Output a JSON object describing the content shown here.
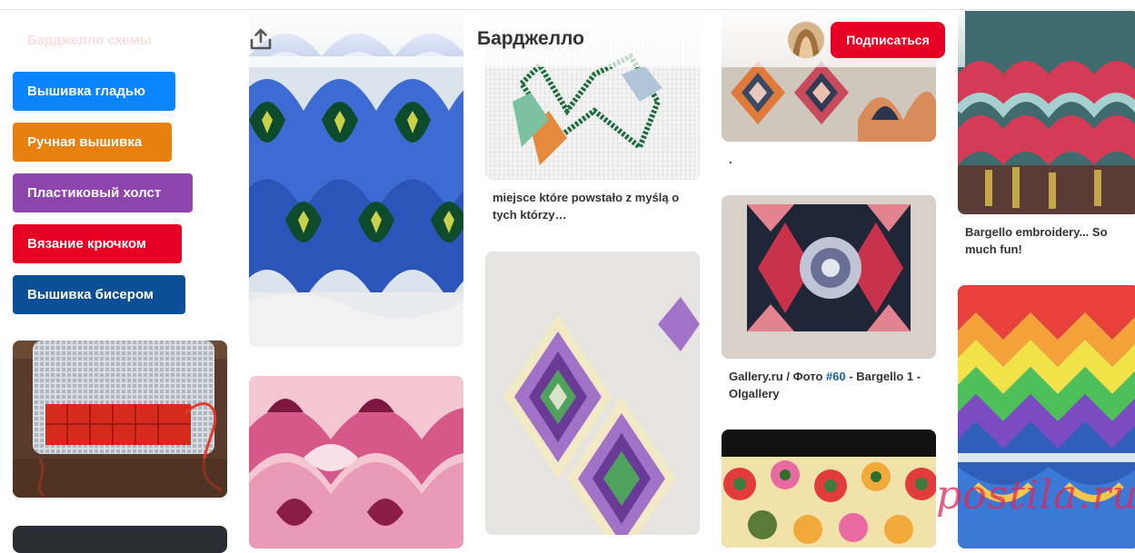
{
  "tags": [
    {
      "label": "Барджелло схемы",
      "color": "#fff0f0"
    },
    {
      "label": "Вышивка гладью",
      "color": "#0a84ff"
    },
    {
      "label": "Ручная вышивка",
      "color": "#e6800e"
    },
    {
      "label": "Пластиковый холст",
      "color": "#8e44ad"
    },
    {
      "label": "Вязание крючком",
      "color": "#e60023"
    },
    {
      "label": "Вышивка бисером",
      "color": "#0b4f96"
    }
  ],
  "header": {
    "title": "Барджелло",
    "subscribe_label": "Подписаться",
    "share_icon": "share-icon",
    "accent": "#e60023"
  },
  "pins": {
    "col2_top_caption": "miejsce które powstało z myślą o tych którzy…",
    "col3_top_caption": ".",
    "col3_mid_caption_prefix": "Gallery.ru / Фото ",
    "col3_mid_caption_link": "#60",
    "col3_mid_caption_suffix": " - Bargello 1 - Olgallery",
    "col4_top_caption": "Bargello embroidery... So much fun!"
  },
  "watermark": "postila.ru"
}
